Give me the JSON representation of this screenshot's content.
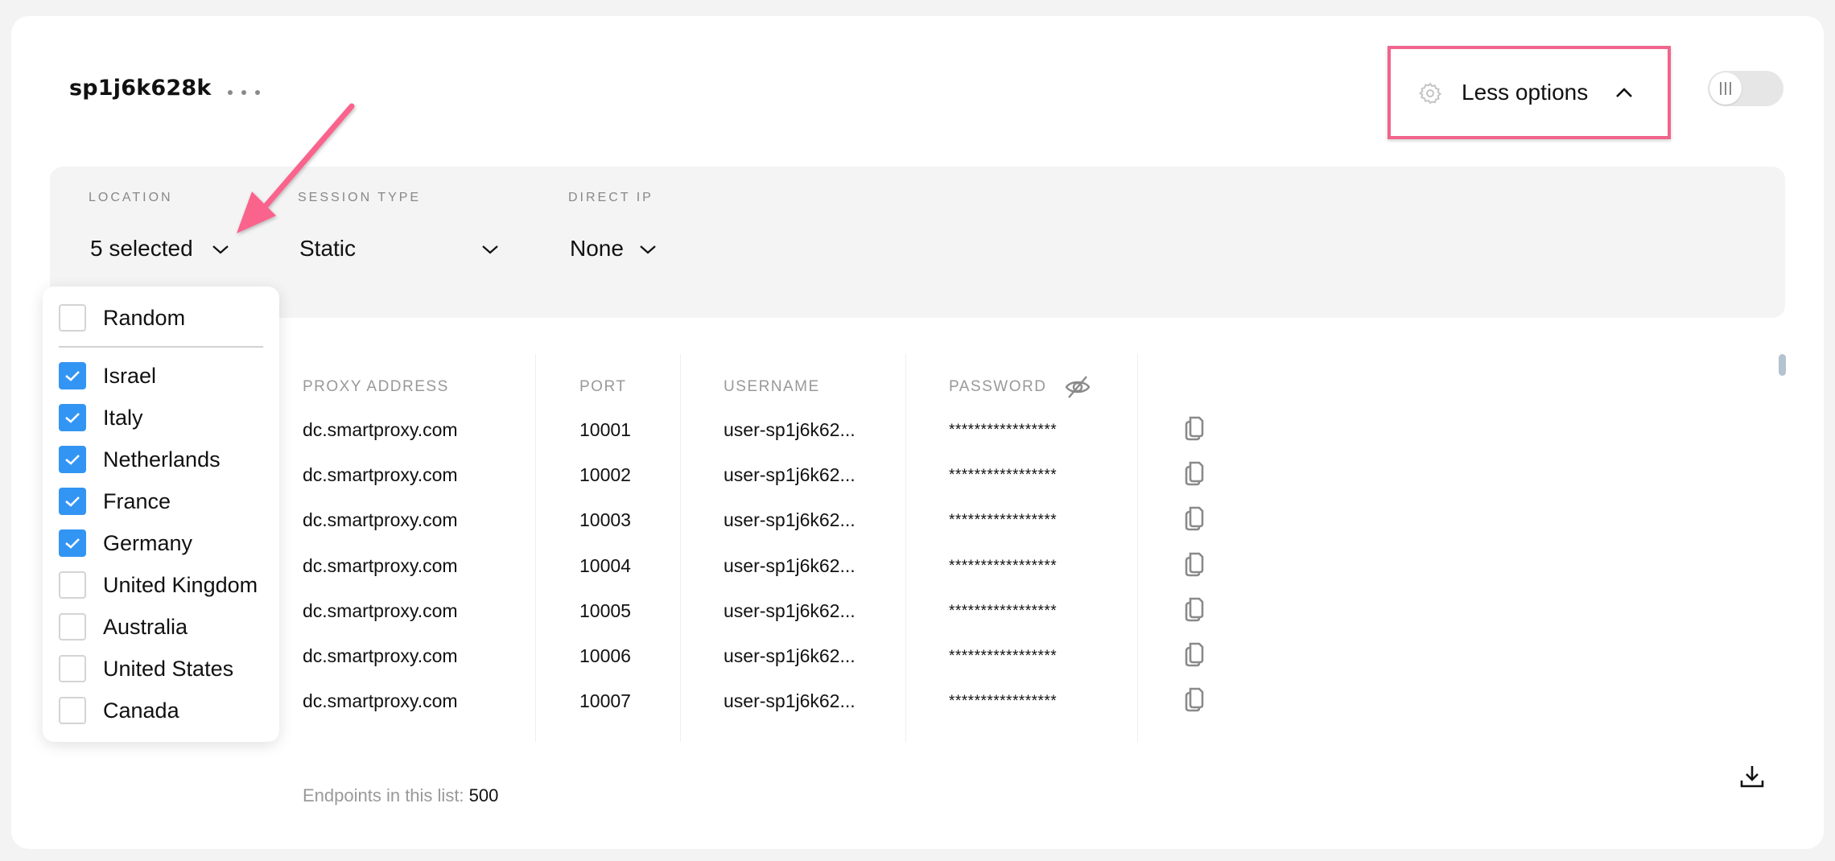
{
  "header": {
    "title": "sp1j6k628k",
    "more_icon": "ellipsis-icon",
    "less_options": {
      "label": "Less options",
      "icon": "gear-icon",
      "chevron": "chevron-up-icon"
    },
    "toggle": {
      "on": false
    }
  },
  "filters": {
    "location": {
      "label": "LOCATION",
      "value": "5 selected"
    },
    "session_type": {
      "label": "SESSION TYPE",
      "value": "Static"
    },
    "direct_ip": {
      "label": "DIRECT IP",
      "value": "None"
    }
  },
  "location_dropdown": {
    "options": [
      {
        "label": "Random",
        "checked": false
      },
      {
        "label": "Israel",
        "checked": true
      },
      {
        "label": "Italy",
        "checked": true
      },
      {
        "label": "Netherlands",
        "checked": true
      },
      {
        "label": "France",
        "checked": true
      },
      {
        "label": "Germany",
        "checked": true
      },
      {
        "label": "United Kingdom",
        "checked": false
      },
      {
        "label": "Australia",
        "checked": false
      },
      {
        "label": "United States",
        "checked": false
      },
      {
        "label": "Canada",
        "checked": false
      }
    ]
  },
  "table": {
    "columns": [
      "PROXY ADDRESS",
      "PORT",
      "USERNAME",
      "PASSWORD"
    ],
    "rows": [
      {
        "address": "dc.smartproxy.com",
        "port": "10001",
        "username": "user-sp1j6k62...",
        "password": "*****************"
      },
      {
        "address": "dc.smartproxy.com",
        "port": "10002",
        "username": "user-sp1j6k62...",
        "password": "*****************"
      },
      {
        "address": "dc.smartproxy.com",
        "port": "10003",
        "username": "user-sp1j6k62...",
        "password": "*****************"
      },
      {
        "address": "dc.smartproxy.com",
        "port": "10004",
        "username": "user-sp1j6k62...",
        "password": "*****************"
      },
      {
        "address": "dc.smartproxy.com",
        "port": "10005",
        "username": "user-sp1j6k62...",
        "password": "*****************"
      },
      {
        "address": "dc.smartproxy.com",
        "port": "10006",
        "username": "user-sp1j6k62...",
        "password": "*****************"
      },
      {
        "address": "dc.smartproxy.com",
        "port": "10007",
        "username": "user-sp1j6k62...",
        "password": "*****************"
      }
    ]
  },
  "footer": {
    "endpoints_label": "Endpoints in this list: ",
    "endpoints_count": "500"
  },
  "colors": {
    "accent_checkbox": "#3395f3",
    "annotation_pink": "#f1648b"
  }
}
